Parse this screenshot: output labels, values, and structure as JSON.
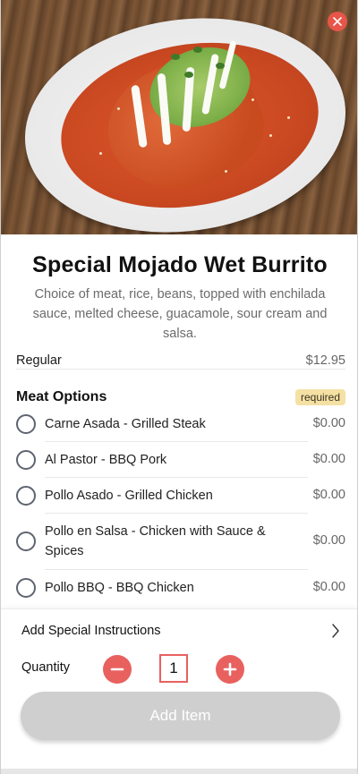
{
  "item": {
    "title": "Special Mojado Wet Burrito",
    "description": "Choice of meat, rice, beans, topped with enchilada sauce, melted cheese, guacamole, sour cream and salsa.",
    "size_label": "Regular",
    "size_price": "$12.95"
  },
  "close_icon": "close-icon",
  "meat_options": {
    "heading": "Meat Options",
    "badge": "required",
    "options": [
      {
        "label": "Carne Asada - Grilled Steak",
        "price": "$0.00",
        "selected": false
      },
      {
        "label": "Al Pastor - BBQ Pork",
        "price": "$0.00",
        "selected": false
      },
      {
        "label": "Pollo Asado - Grilled Chicken",
        "price": "$0.00",
        "selected": false
      },
      {
        "label": "Pollo en Salsa - Chicken with Sauce & Spices",
        "price": "$0.00",
        "selected": false
      },
      {
        "label": "Pollo BBQ - BBQ Chicken",
        "price": "$0.00",
        "selected": false
      }
    ]
  },
  "footer": {
    "instructions_label": "Add Special Instructions",
    "quantity_label": "Quantity",
    "quantity_value": "1",
    "add_button_label": "Add Item"
  },
  "colors": {
    "accent": "#e8615f",
    "badge_bg": "#f4e1a3",
    "disabled_button": "#cfcfcf"
  }
}
